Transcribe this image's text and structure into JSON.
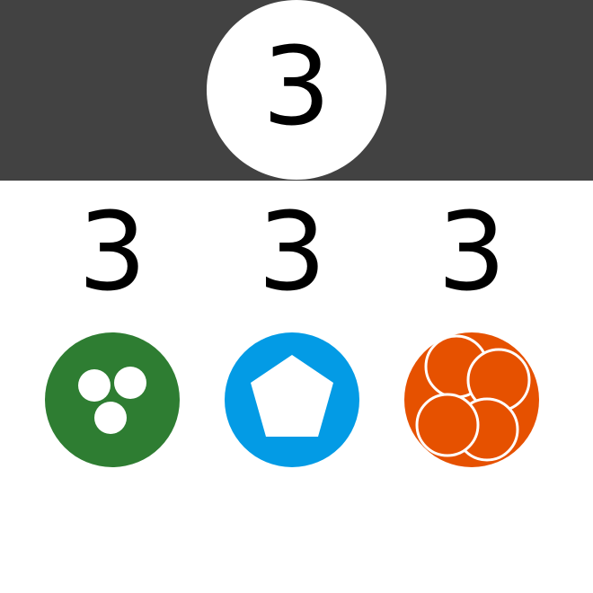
{
  "target": {
    "value": "3"
  },
  "options": [
    {
      "value": "3",
      "icon": "three-dots-icon",
      "color": "#2e7d32"
    },
    {
      "value": "3",
      "icon": "pentagon-icon",
      "color": "#039be5"
    },
    {
      "value": "3",
      "icon": "four-circles-icon",
      "color": "#e65100"
    }
  ],
  "colors": {
    "top_bar": "#424242",
    "background": "#ffffff",
    "text": "#000000"
  }
}
